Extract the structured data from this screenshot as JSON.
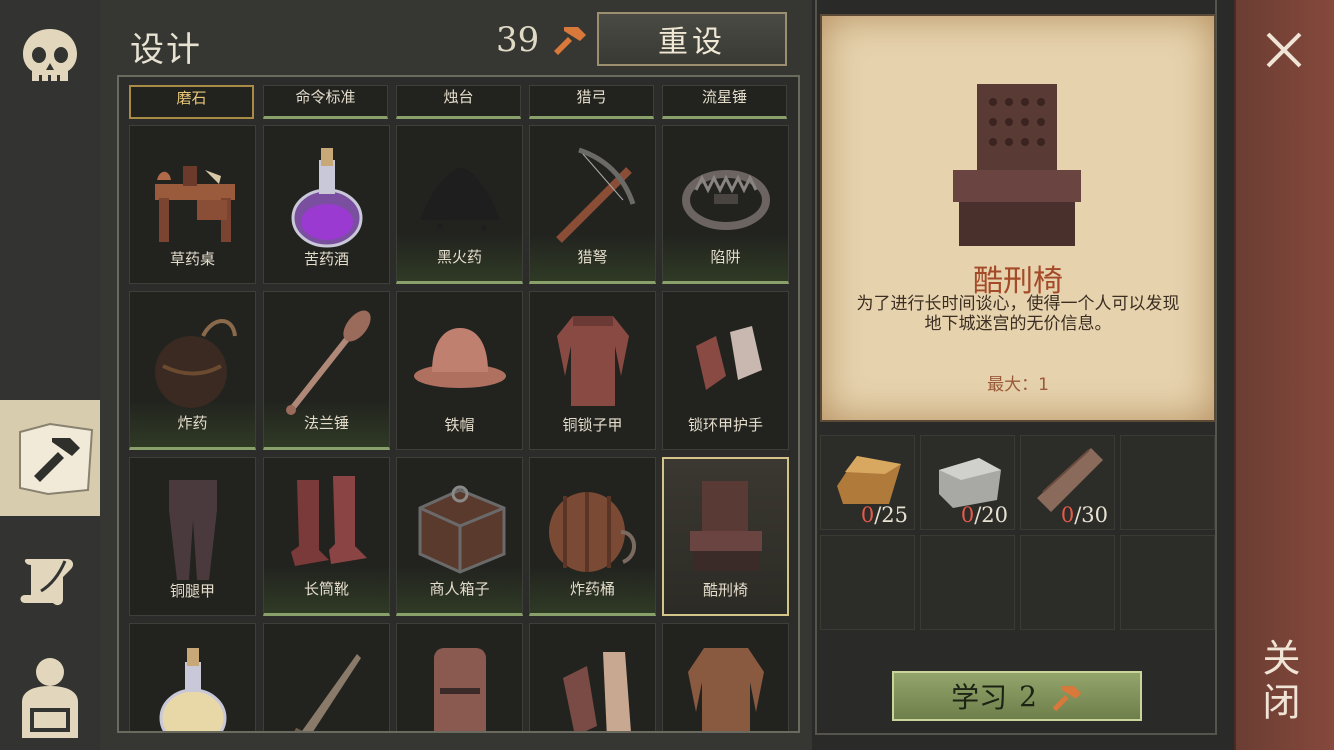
{
  "header": {
    "title": "设计",
    "points": "39",
    "reset_label": "重设"
  },
  "nav": {
    "items": [
      {
        "name": "skull-icon"
      },
      {
        "name": "craft-hammer-icon",
        "active": true
      },
      {
        "name": "scroll-quill-icon"
      },
      {
        "name": "character-backpack-icon"
      }
    ]
  },
  "grid": {
    "top_row": [
      "磨石",
      "命令标准",
      "烛台",
      "猎弓",
      "流星锤"
    ],
    "rows": [
      [
        {
          "label": "草药桌",
          "unlocked": false
        },
        {
          "label": "苦药酒",
          "unlocked": false
        },
        {
          "label": "黑火药",
          "unlocked": true
        },
        {
          "label": "猎弩",
          "unlocked": true
        },
        {
          "label": "陷阱",
          "unlocked": true
        }
      ],
      [
        {
          "label": "炸药",
          "unlocked": true
        },
        {
          "label": "法兰锤",
          "unlocked": true
        },
        {
          "label": "铁帽",
          "unlocked": false
        },
        {
          "label": "铜锁子甲",
          "unlocked": false
        },
        {
          "label": "锁环甲护手",
          "unlocked": false
        }
      ],
      [
        {
          "label": "铜腿甲",
          "unlocked": false
        },
        {
          "label": "长筒靴",
          "unlocked": true
        },
        {
          "label": "商人箱子",
          "unlocked": true
        },
        {
          "label": "炸药桶",
          "unlocked": true
        },
        {
          "label": "酷刑椅",
          "unlocked": true,
          "selected": true
        }
      ],
      [
        {
          "label": "",
          "unlocked": false
        },
        {
          "label": "",
          "unlocked": false
        },
        {
          "label": "",
          "unlocked": false
        },
        {
          "label": "",
          "unlocked": false
        },
        {
          "label": "",
          "unlocked": false
        }
      ]
    ]
  },
  "detail": {
    "name": "酷刑椅",
    "description": "为了进行长时间谈心，使得一个人可以发现地下城迷宫的无价信息。",
    "max_label": "最大：1"
  },
  "ingredients": [
    {
      "icon": "copper-ingot-icon",
      "have": "0",
      "need": "/25"
    },
    {
      "icon": "stone-block-icon",
      "have": "0",
      "need": "/20"
    },
    {
      "icon": "wood-plank-icon",
      "have": "0",
      "need": "/30"
    }
  ],
  "learn": {
    "label": "学习",
    "cost": "2"
  },
  "close": {
    "label": "关闭"
  },
  "colors": {
    "accent_red": "#a44a28",
    "learn_green": "#93a46b",
    "close_brown": "#86493c"
  }
}
